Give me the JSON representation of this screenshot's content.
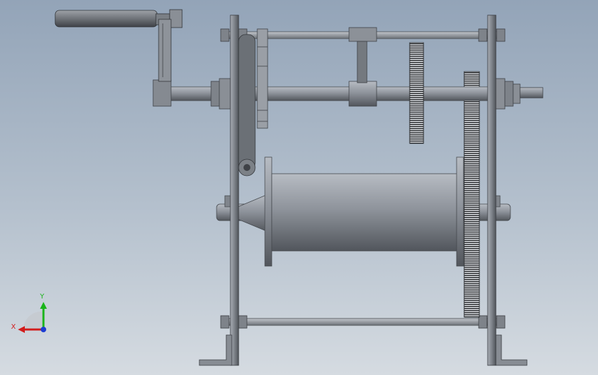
{
  "triad": {
    "x_label": "X",
    "y_label": "Y"
  },
  "colors": {
    "background_top": "#93a4b8",
    "background_bottom": "#d5dbe1",
    "part_fill": "#8e939b",
    "part_dark": "#55595f",
    "x_axis": "#d21c1c",
    "y_axis": "#19b419",
    "z_axis": "#1c3cd2"
  }
}
